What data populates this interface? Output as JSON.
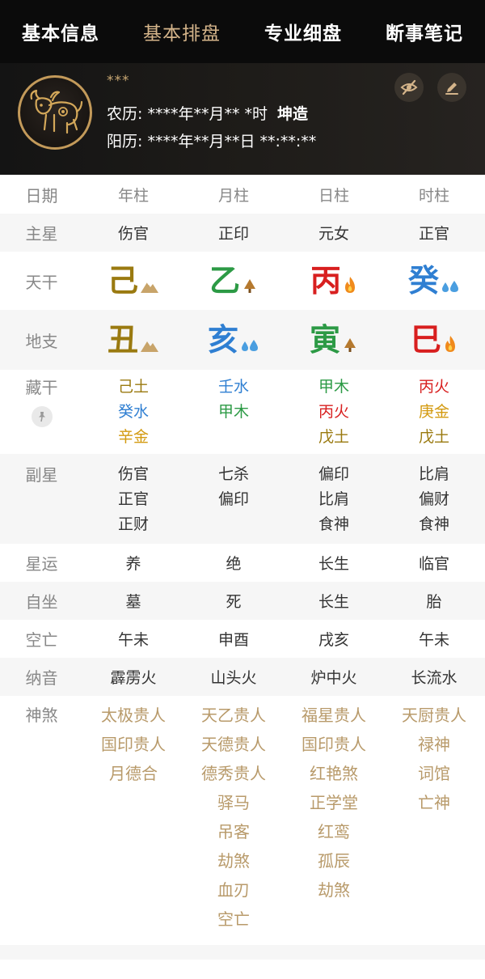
{
  "tabs": [
    "基本信息",
    "基本排盘",
    "专业细盘",
    "断事笔记"
  ],
  "header": {
    "name": "***",
    "lunar": "农历:  ****年**月** *时",
    "gender": "坤造",
    "solar": "阳历:  ****年**月**日 **:**:**"
  },
  "grid": {
    "date_label": "日期",
    "columns": [
      "年柱",
      "月柱",
      "日柱",
      "时柱"
    ],
    "main_star": {
      "label": "主星",
      "values": [
        "伤官",
        "正印",
        "元女",
        "正官"
      ]
    },
    "tiangan": {
      "label": "天干",
      "values": [
        {
          "char": "己",
          "element": "earth",
          "icon": "mountain-icon"
        },
        {
          "char": "乙",
          "element": "wood",
          "icon": "tree-icon"
        },
        {
          "char": "丙",
          "element": "fire",
          "icon": "flame-icon"
        },
        {
          "char": "癸",
          "element": "water",
          "icon": "water-drops-icon"
        }
      ]
    },
    "dizhi": {
      "label": "地支",
      "values": [
        {
          "char": "丑",
          "element": "earth",
          "icon": "mountain-icon"
        },
        {
          "char": "亥",
          "element": "water",
          "icon": "water-drops-icon"
        },
        {
          "char": "寅",
          "element": "wood",
          "icon": "tree-icon"
        },
        {
          "char": "巳",
          "element": "fire",
          "icon": "flame-icon"
        }
      ]
    },
    "canggan": {
      "label": "藏干",
      "values": [
        [
          {
            "text": "己土",
            "element": "earth"
          },
          {
            "text": "癸水",
            "element": "water"
          },
          {
            "text": "辛金",
            "element": "metal"
          }
        ],
        [
          {
            "text": "壬水",
            "element": "water"
          },
          {
            "text": "甲木",
            "element": "wood"
          }
        ],
        [
          {
            "text": "甲木",
            "element": "wood"
          },
          {
            "text": "丙火",
            "element": "fire"
          },
          {
            "text": "戊土",
            "element": "earth"
          }
        ],
        [
          {
            "text": "丙火",
            "element": "fire"
          },
          {
            "text": "庚金",
            "element": "metal"
          },
          {
            "text": "戊土",
            "element": "earth"
          }
        ]
      ]
    },
    "fuxing": {
      "label": "副星",
      "values": [
        [
          "伤官",
          "正官",
          "正财"
        ],
        [
          "七杀",
          "偏印"
        ],
        [
          "偏印",
          "比肩",
          "食神"
        ],
        [
          "比肩",
          "偏财",
          "食神"
        ]
      ]
    },
    "xingyun": {
      "label": "星运",
      "values": [
        "养",
        "绝",
        "长生",
        "临官"
      ]
    },
    "zizuo": {
      "label": "自坐",
      "values": [
        "墓",
        "死",
        "长生",
        "胎"
      ]
    },
    "kongwang": {
      "label": "空亡",
      "values": [
        "午未",
        "申酉",
        "戌亥",
        "午未"
      ]
    },
    "nayin": {
      "label": "纳音",
      "values": [
        "霹雳火",
        "山头火",
        "炉中火",
        "长流水"
      ]
    },
    "shensha": {
      "label": "神煞",
      "values": [
        [
          "太极贵人",
          "国印贵人",
          "月德合"
        ],
        [
          "天乙贵人",
          "天德贵人",
          "德秀贵人",
          "驿马",
          "吊客",
          "劫煞",
          "血刃",
          "空亡"
        ],
        [
          "福星贵人",
          "国印贵人",
          "红艳煞",
          "正学堂",
          "红鸾",
          "孤辰",
          "劫煞"
        ],
        [
          "天厨贵人",
          "禄神",
          "词馆",
          "亡神"
        ]
      ]
    }
  },
  "colors": {
    "earth": "#9a7a10",
    "water": "#2f7fd2",
    "wood": "#2c9a45",
    "fire": "#d81f1f",
    "metal": "#d39a10",
    "accent": "#d4b48a"
  }
}
